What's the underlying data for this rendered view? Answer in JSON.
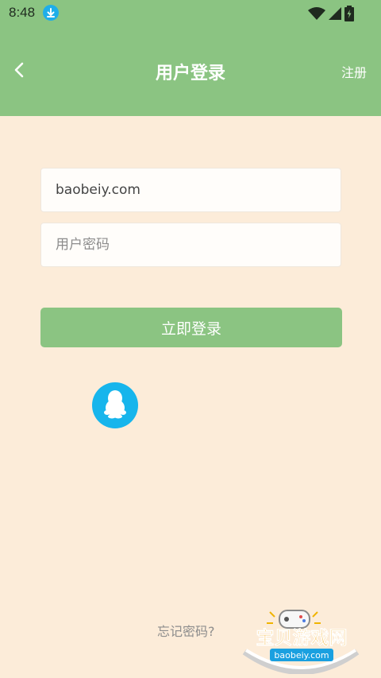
{
  "status_bar": {
    "time": "8:48",
    "download_icon": "download-icon",
    "wifi_icon": "wifi-icon",
    "signal_icon": "signal-icon",
    "battery_icon": "battery-icon"
  },
  "header": {
    "title": "用户登录",
    "back_icon": "back-arrow-icon",
    "register_label": "注册"
  },
  "form": {
    "username_value": "baobeiy.com",
    "password_placeholder": "用户密码"
  },
  "login_button": {
    "label": "立即登录"
  },
  "social": {
    "qq_icon": "qq-penguin-icon"
  },
  "footer": {
    "forgot_label": "忘记密码?"
  },
  "watermark": {
    "text": "宝贝游戏网",
    "subtext": "baobeiy.com"
  },
  "colors": {
    "header_green": "#8bc482",
    "background": "#fcecd9",
    "qq_blue": "#17b5ec",
    "button_green": "#8bc482",
    "text_gray": "#8d8d8d"
  }
}
